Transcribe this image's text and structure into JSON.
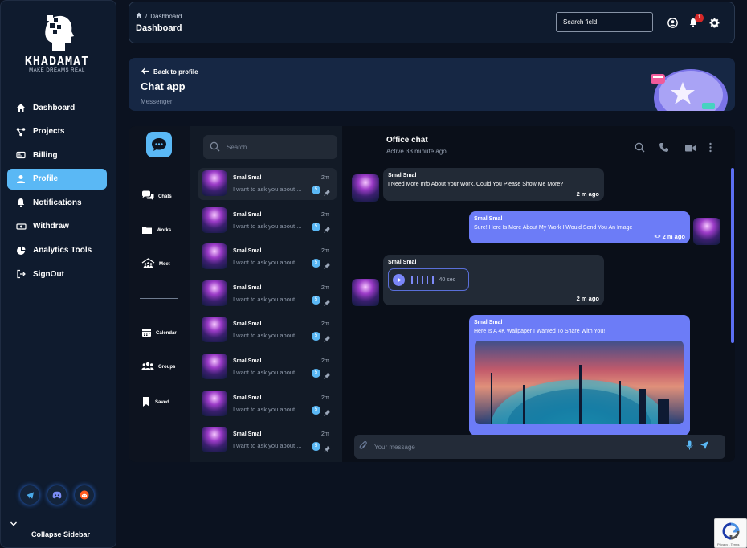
{
  "brand": {
    "name": "KHADAMAT",
    "tagline": "MAKE DREAMS REAL"
  },
  "sidebar": {
    "items": [
      {
        "label": "Dashboard",
        "icon": "home-icon"
      },
      {
        "label": "Projects",
        "icon": "projects-icon"
      },
      {
        "label": "Billing",
        "icon": "billing-icon"
      },
      {
        "label": "Profile",
        "icon": "profile-icon",
        "active": true
      },
      {
        "label": "Notifications",
        "icon": "bell-icon"
      },
      {
        "label": "Withdraw",
        "icon": "withdraw-icon"
      },
      {
        "label": "Analytics Tools",
        "icon": "pie-chart-icon"
      },
      {
        "label": "SignOut",
        "icon": "sign-out-icon"
      }
    ],
    "socials": [
      "telegram-icon",
      "discord-icon",
      "reddit-icon"
    ],
    "collapse_label": "Collapse Sidebar"
  },
  "topbar": {
    "breadcrumb": "Dashboard",
    "title": "Dashboard",
    "search_placeholder": "Search field",
    "notification_count": "1"
  },
  "chat_header": {
    "back_label": "Back to profile",
    "title": "Chat app",
    "subtitle": "Messenger"
  },
  "rail": {
    "items": [
      {
        "label": "Chats",
        "icon": "chats-icon"
      },
      {
        "label": "Works",
        "icon": "folder-icon"
      },
      {
        "label": "Meet",
        "icon": "meet-icon"
      },
      {
        "label": "Calendar",
        "icon": "calendar-icon"
      },
      {
        "label": "Groups",
        "icon": "groups-icon"
      },
      {
        "label": "Saved",
        "icon": "bookmark-icon"
      }
    ]
  },
  "conversations": {
    "search_placeholder": "Search",
    "items": [
      {
        "name": "Smal Smal",
        "preview": "I want to ask you about ...",
        "time": "2m",
        "unread": "5"
      },
      {
        "name": "Smal Smal",
        "preview": "I want to ask you about ...",
        "time": "2m",
        "unread": "5"
      },
      {
        "name": "Smal Smal",
        "preview": "I want to ask you about ...",
        "time": "2m",
        "unread": "5"
      },
      {
        "name": "Smal Smal",
        "preview": "I want to ask you about ...",
        "time": "2m",
        "unread": "5"
      },
      {
        "name": "Smal Smal",
        "preview": "I want to ask you about ...",
        "time": "2m",
        "unread": "5"
      },
      {
        "name": "Smal Smal",
        "preview": "I want to ask you about ...",
        "time": "2m",
        "unread": "5"
      },
      {
        "name": "Smal Smal",
        "preview": "I want to ask you about ...",
        "time": "2m",
        "unread": "5"
      },
      {
        "name": "Smal Smal",
        "preview": "I want to ask you about ...",
        "time": "2m",
        "unread": "5"
      }
    ]
  },
  "chat": {
    "title": "Office chat",
    "status": "Active 33 minute ago",
    "messages": [
      {
        "sender": "Smal Smal",
        "text": "I Need More Info About Your Work. Could You Please Show Me More?",
        "time": "2 m ago"
      },
      {
        "sender": "Smal Smal",
        "text": "Sure! Here Is More About My Work I Would Send You An Image",
        "time": "2 m ago"
      },
      {
        "sender": "Smal Smal",
        "duration": "40 sec",
        "time": "2 m ago"
      },
      {
        "sender": "Smal Smal",
        "text": "Here Is A 4K Wallpaper I Wanted To Share With You!"
      }
    ],
    "composer_placeholder": "Your message"
  },
  "recaptcha": {
    "text": "Privacy - Terms"
  },
  "colors": {
    "accent": "#5ab8f5",
    "bubble_out": "#6c7cf7",
    "bubble_in": "#222a36",
    "badge": "#d62828"
  }
}
